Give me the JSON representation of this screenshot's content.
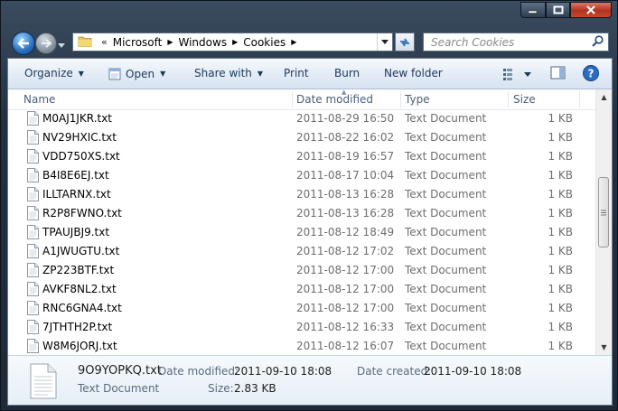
{
  "window": {
    "buttons": [
      "minimize",
      "maximize",
      "close"
    ]
  },
  "address": {
    "overflow": "«",
    "segments": [
      "Microsoft",
      "Windows",
      "Cookies"
    ]
  },
  "search": {
    "placeholder": "Search Cookies"
  },
  "toolbar": {
    "organize": "Organize",
    "open": "Open",
    "share_with": "Share with",
    "print": "Print",
    "burn": "Burn",
    "new_folder": "New folder"
  },
  "columns": {
    "name": "Name",
    "date_modified": "Date modified",
    "type": "Type",
    "size": "Size"
  },
  "files": [
    {
      "name": "M0AJ1JKR.txt",
      "date": "2011-08-29 16:50",
      "type": "Text Document",
      "size": "1 KB"
    },
    {
      "name": "NV29HXIC.txt",
      "date": "2011-08-22 16:02",
      "type": "Text Document",
      "size": "1 KB"
    },
    {
      "name": "VDD750XS.txt",
      "date": "2011-08-19 16:57",
      "type": "Text Document",
      "size": "1 KB"
    },
    {
      "name": "B4I8E6EJ.txt",
      "date": "2011-08-17 10:04",
      "type": "Text Document",
      "size": "1 KB"
    },
    {
      "name": "ILLTARNX.txt",
      "date": "2011-08-13 16:28",
      "type": "Text Document",
      "size": "1 KB"
    },
    {
      "name": "R2P8FWNO.txt",
      "date": "2011-08-13 16:28",
      "type": "Text Document",
      "size": "1 KB"
    },
    {
      "name": "TPAUJBJ9.txt",
      "date": "2011-08-12 18:49",
      "type": "Text Document",
      "size": "1 KB"
    },
    {
      "name": "A1JWUGTU.txt",
      "date": "2011-08-12 17:02",
      "type": "Text Document",
      "size": "1 KB"
    },
    {
      "name": "ZP223BTF.txt",
      "date": "2011-08-12 17:00",
      "type": "Text Document",
      "size": "1 KB"
    },
    {
      "name": "AVKF8NL2.txt",
      "date": "2011-08-12 17:00",
      "type": "Text Document",
      "size": "1 KB"
    },
    {
      "name": "RNC6GNA4.txt",
      "date": "2011-08-12 17:00",
      "type": "Text Document",
      "size": "1 KB"
    },
    {
      "name": "7JTHTH2P.txt",
      "date": "2011-08-12 16:33",
      "type": "Text Document",
      "size": "1 KB"
    },
    {
      "name": "W8M6JORJ.txt",
      "date": "2011-08-12 16:07",
      "type": "Text Document",
      "size": "1 KB"
    }
  ],
  "details": {
    "filename": "9O9YOPKQ.txt",
    "filetype": "Text Document",
    "date_modified_label": "Date modified:",
    "date_modified": "2011-09-10 18:08",
    "date_created_label": "Date created:",
    "date_created": "2011-09-10 18:08",
    "size_label": "Size:",
    "size": "2.83 KB"
  }
}
